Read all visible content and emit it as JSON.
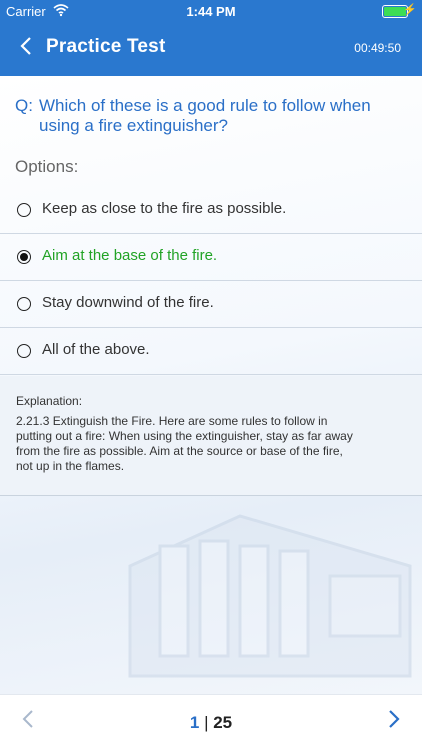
{
  "status_bar": {
    "carrier": "Carrier",
    "time": "1:44 PM",
    "battery_color": "#3ddc55"
  },
  "nav": {
    "back_icon": "chevron-left-icon",
    "title": "Practice Test",
    "timer": "00:49:50",
    "color": "#2a78cf"
  },
  "question": {
    "prefix": "Q:",
    "text": "Which of these is a good rule to follow when using a fire extinguisher?"
  },
  "options_label": "Options:",
  "options": [
    {
      "label": "Keep as close to the fire as possible.",
      "selected": false
    },
    {
      "label": "Aim at the base of the fire.",
      "selected": true
    },
    {
      "label": "Stay downwind of the fire.",
      "selected": false
    },
    {
      "label": "All of the above.",
      "selected": false
    }
  ],
  "explanation": {
    "title": "Explanation:",
    "text": "2.21.3 Extinguish the Fire. Here are some rules to follow in putting out a fire: When using the extinguisher, stay as far away from the fire as possible. Aim at the source or base of the fire, not up in the flames."
  },
  "footer": {
    "prev_icon": "chevron-left-icon",
    "next_icon": "chevron-right-icon",
    "current_page": "1",
    "separator": "|",
    "total_pages": "25"
  },
  "colors": {
    "accent": "#2a6fc7",
    "correct": "#22a326"
  }
}
